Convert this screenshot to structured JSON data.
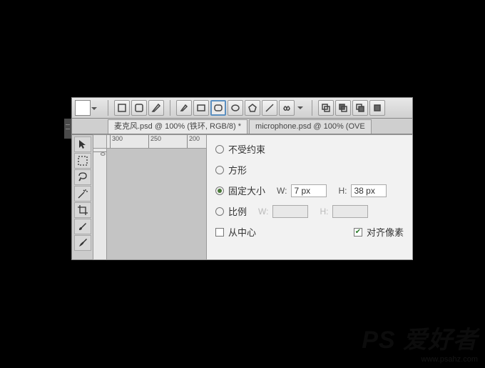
{
  "options_bar": {
    "swatch_color": "#ffffff",
    "shape_icons": [
      "rect",
      "roundrect",
      "pen",
      "pen2",
      "rect2",
      "roundrect2",
      "ellipse",
      "polygon",
      "line",
      "custom"
    ],
    "layer_icons": [
      "exclude",
      "subtract",
      "intersect",
      "add"
    ]
  },
  "tabs": [
    {
      "label": "麦克风.psd @ 100% (铁环, RGB/8) *",
      "active": true
    },
    {
      "label": "microphone.psd @ 100% (OVE",
      "active": false
    }
  ],
  "tools": [
    "move",
    "marquee",
    "lasso",
    "magicwand",
    "crop",
    "brush",
    "brush2"
  ],
  "ruler": {
    "h": [
      "300",
      "250",
      "200"
    ],
    "v": [
      "0"
    ]
  },
  "popup": {
    "options": {
      "unconstrained": "不受约束",
      "square": "方形",
      "fixed_size": "固定大小",
      "proportional": "比例",
      "from_center": "从中心",
      "align_pixels": "对齐像素"
    },
    "w_label": "W:",
    "h_label": "H:",
    "w_value": "7 px",
    "h_value": "38 px",
    "selected": "fixed_size",
    "from_center_checked": false,
    "align_pixels_checked": true
  },
  "watermark": {
    "logo": "PS 爱好者",
    "url": "www.psahz.com"
  }
}
